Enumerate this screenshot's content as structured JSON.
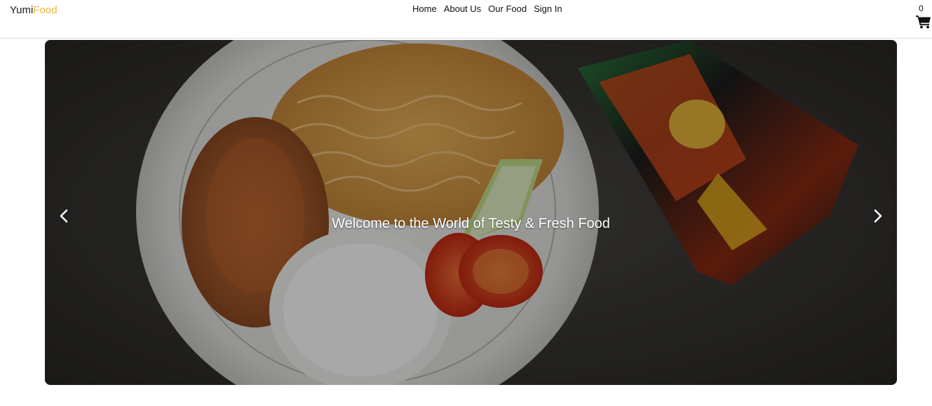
{
  "brand": {
    "part1": "Yumi",
    "part2": "Food",
    "accent_color": "#f4b73c"
  },
  "nav": {
    "links": [
      "Home",
      "About Us",
      "Our Food",
      "Sign In"
    ]
  },
  "cart": {
    "count": "0",
    "icon": "shopping-cart-icon"
  },
  "hero": {
    "caption": "Welcome to the World of Testy & Fresh Food",
    "prev_icon": "chevron-left-icon",
    "next_icon": "chevron-right-icon",
    "image": "food-plate-photo"
  }
}
